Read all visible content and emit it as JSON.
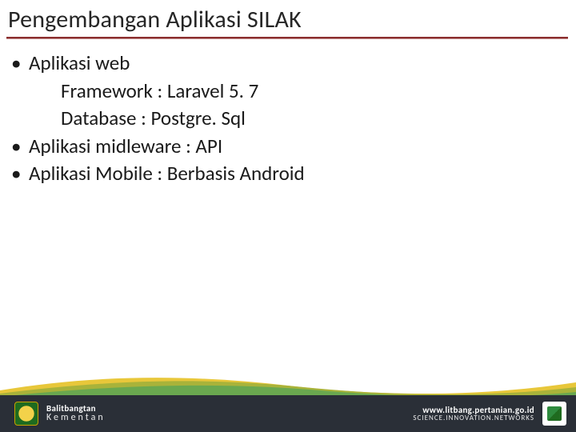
{
  "title": "Pengembangan Aplikasi SILAK",
  "bullets": {
    "b1": "Aplikasi web",
    "b1_sub1": "Framework : Laravel 5. 7",
    "b1_sub2": "Database : Postgre. Sql",
    "b2": "Aplikasi midleware : API",
    "b3": "Aplikasi Mobile : Berbasis Android"
  },
  "footer": {
    "left1": "Balitbangtan",
    "left2": "Kementan",
    "right1": "www.litbang.pertanian.go.id",
    "right2": "SCIENCE.INNOVATION.NETWORKS"
  },
  "colors": {
    "rule": "#8b2e2e",
    "footer_bg": "#2a2f37",
    "wave_green": "#6aa84f",
    "wave_olive": "#a9b33a",
    "wave_yellow": "#e8c73a"
  }
}
